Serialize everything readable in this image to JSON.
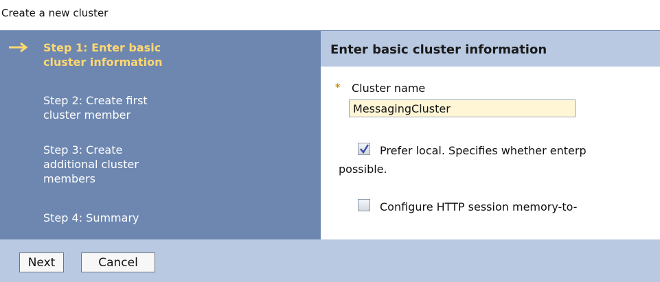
{
  "page": {
    "title": "Create a new cluster"
  },
  "steps": [
    {
      "line1": "Step 1: Enter basic",
      "line2": "cluster information"
    },
    {
      "line1": "Step 2: Create first",
      "line2": "cluster member"
    },
    {
      "line1": "Step 3: Create",
      "line2": "additional cluster",
      "line3": "members"
    },
    {
      "line1": "Step 4: Summary"
    }
  ],
  "current_step_icon": "arrow-right-icon",
  "content": {
    "title": "Enter basic cluster information",
    "cluster_name": {
      "label": "Cluster name",
      "required_marker": "*",
      "value": "MessagingCluster"
    },
    "prefer_local": {
      "checked": true,
      "text_line1": "Prefer local. Specifies whether enterp",
      "text_line2": "possible."
    },
    "http_session": {
      "checked": false,
      "text": "Configure HTTP session memory-to-"
    }
  },
  "buttons": {
    "next": "Next",
    "cancel": "Cancel"
  },
  "colors": {
    "nav_background": "#6d87b1",
    "current_step": "#ffd870",
    "header_background": "#b9c9e2",
    "input_background": "#fff6d6"
  }
}
